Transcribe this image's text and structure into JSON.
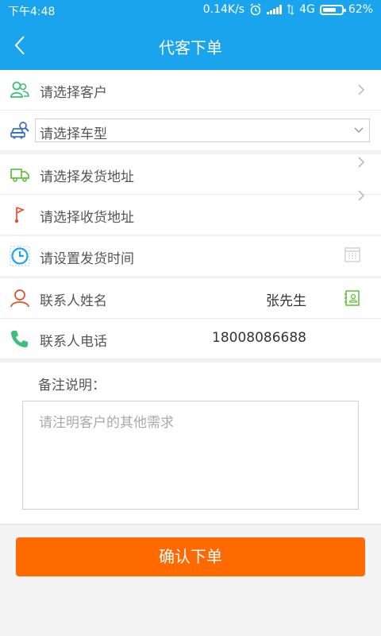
{
  "status_bar": {
    "time": "下午4:48",
    "net_speed": "0.14K/s",
    "network": "4G",
    "battery": "62%"
  },
  "header": {
    "title": "代客下单"
  },
  "form": {
    "customer_label": "请选择客户",
    "vehicle_label": "请选择车型",
    "ship_address_label": "请选择发货地址",
    "receive_address_label": "请选择收货地址",
    "ship_time_label": "请设置发货时间",
    "contact_name_label": "联系人姓名",
    "contact_name_value": "张先生",
    "contact_phone_label": "联系人电话",
    "contact_phone_value": "18008086688",
    "remarks_label": "备注说明：",
    "remarks_placeholder": "请注明客户的其他需求"
  },
  "actions": {
    "confirm_label": "确认下单"
  },
  "colors": {
    "accent": "#1ba4ee",
    "primary_button": "#ff6a00"
  },
  "icons": {
    "customer": "customers-icon",
    "vehicle": "car-search-icon",
    "ship_address": "truck-icon",
    "receive_address": "flag-pin-icon",
    "ship_time": "clock-icon",
    "calendar": "calendar-icon",
    "contact_name": "person-icon",
    "contacts_book": "contact-book-icon",
    "contact_phone": "phone-icon"
  }
}
